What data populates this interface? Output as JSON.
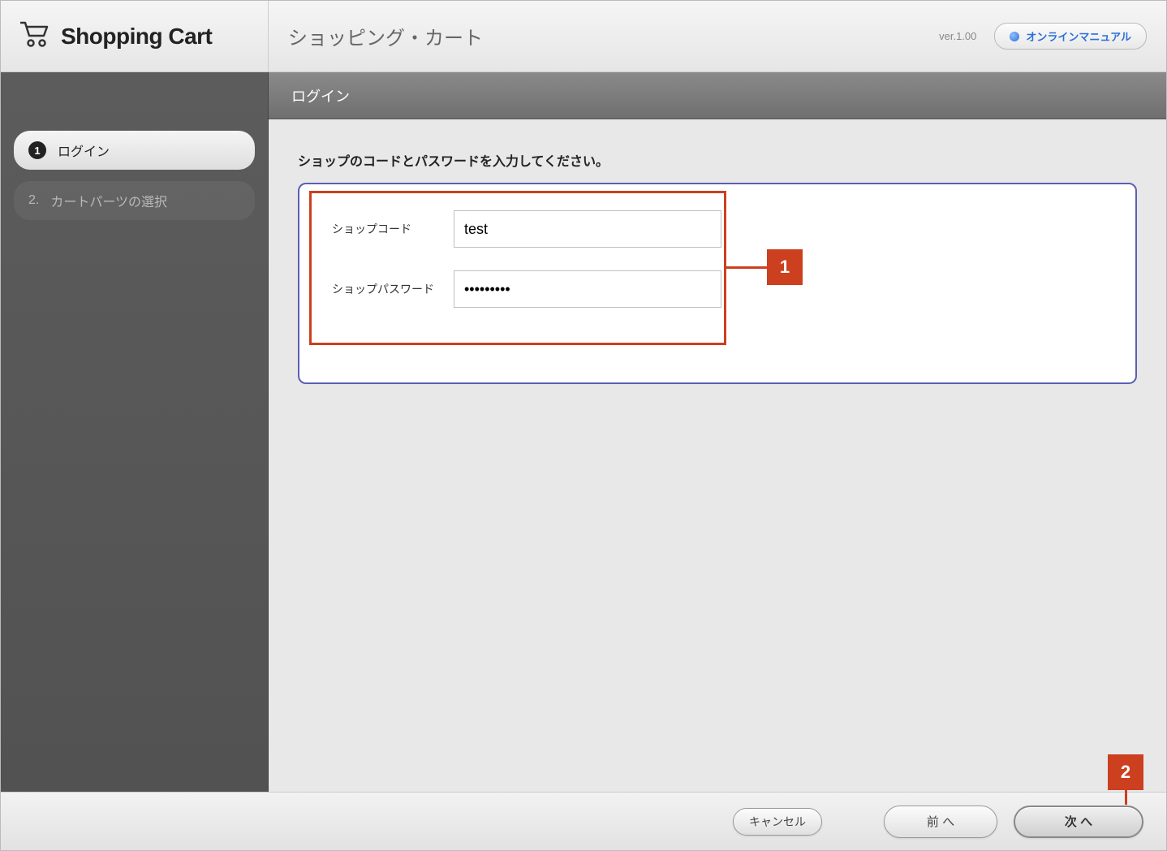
{
  "logo": {
    "text": "Shopping Cart"
  },
  "header": {
    "title": "ショッピング・カート",
    "version": "ver.1.00",
    "manual_button": "オンラインマニュアル"
  },
  "sidebar": {
    "steps": [
      {
        "num": "1",
        "label": "ログイン",
        "active": true
      },
      {
        "num": "2.",
        "label": "カートパーツの選択",
        "active": false
      }
    ]
  },
  "subheader": {
    "title": "ログイン"
  },
  "content": {
    "instruction": "ショップのコードとパスワードを入力してください。",
    "fields": {
      "shop_code": {
        "label": "ショップコード",
        "value": "test"
      },
      "shop_password": {
        "label": "ショップパスワード",
        "value": "•••••••••"
      }
    }
  },
  "callouts": {
    "one": "1",
    "two": "2"
  },
  "footer": {
    "cancel": "キャンセル",
    "prev": "前 へ",
    "next": "次 へ"
  }
}
